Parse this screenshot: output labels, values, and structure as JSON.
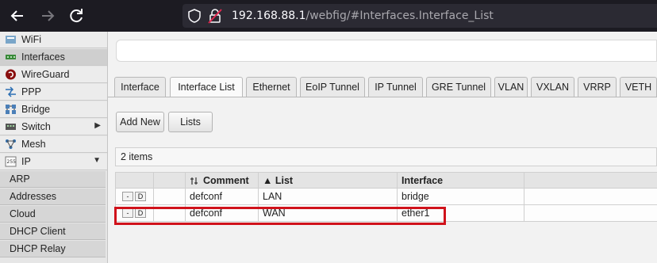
{
  "browser": {
    "url_host": "192.168.88.1",
    "url_path": "/webfig/#Interfaces.Interface_List"
  },
  "sidebar": {
    "items": [
      {
        "label": "WiFi",
        "icon": "wifi-icon"
      },
      {
        "label": "Interfaces",
        "icon": "interfaces-icon",
        "active": true
      },
      {
        "label": "WireGuard",
        "icon": "wireguard-icon"
      },
      {
        "label": "PPP",
        "icon": "ppp-icon"
      },
      {
        "label": "Bridge",
        "icon": "bridge-icon"
      },
      {
        "label": "Switch",
        "icon": "switch-icon",
        "arrow": "▶"
      },
      {
        "label": "Mesh",
        "icon": "mesh-icon"
      },
      {
        "label": "IP",
        "icon": "ip-icon",
        "arrow": "▼"
      }
    ],
    "subitems": [
      "ARP",
      "Addresses",
      "Cloud",
      "DHCP Client",
      "DHCP Relay"
    ]
  },
  "tabs": [
    "Interface",
    "Interface List",
    "Ethernet",
    "EoIP Tunnel",
    "IP Tunnel",
    "GRE Tunnel",
    "VLAN",
    "VXLAN",
    "VRRP",
    "VETH"
  ],
  "active_tab": "Interface List",
  "buttons": {
    "add_new": "Add New",
    "lists": "Lists"
  },
  "item_count": "2 items",
  "table": {
    "headers": {
      "comment": "Comment",
      "list": "▲ List",
      "interface": "Interface"
    },
    "rows": [
      {
        "remove": "-",
        "disable": "D",
        "comment": "defconf",
        "list": "LAN",
        "interface": "bridge"
      },
      {
        "remove": "-",
        "disable": "D",
        "comment": "defconf",
        "list": "WAN",
        "interface": "ether1",
        "highlighted": true
      }
    ]
  },
  "colors": {
    "highlight": "#d0121b",
    "browser_bg": "#1c1b22"
  }
}
